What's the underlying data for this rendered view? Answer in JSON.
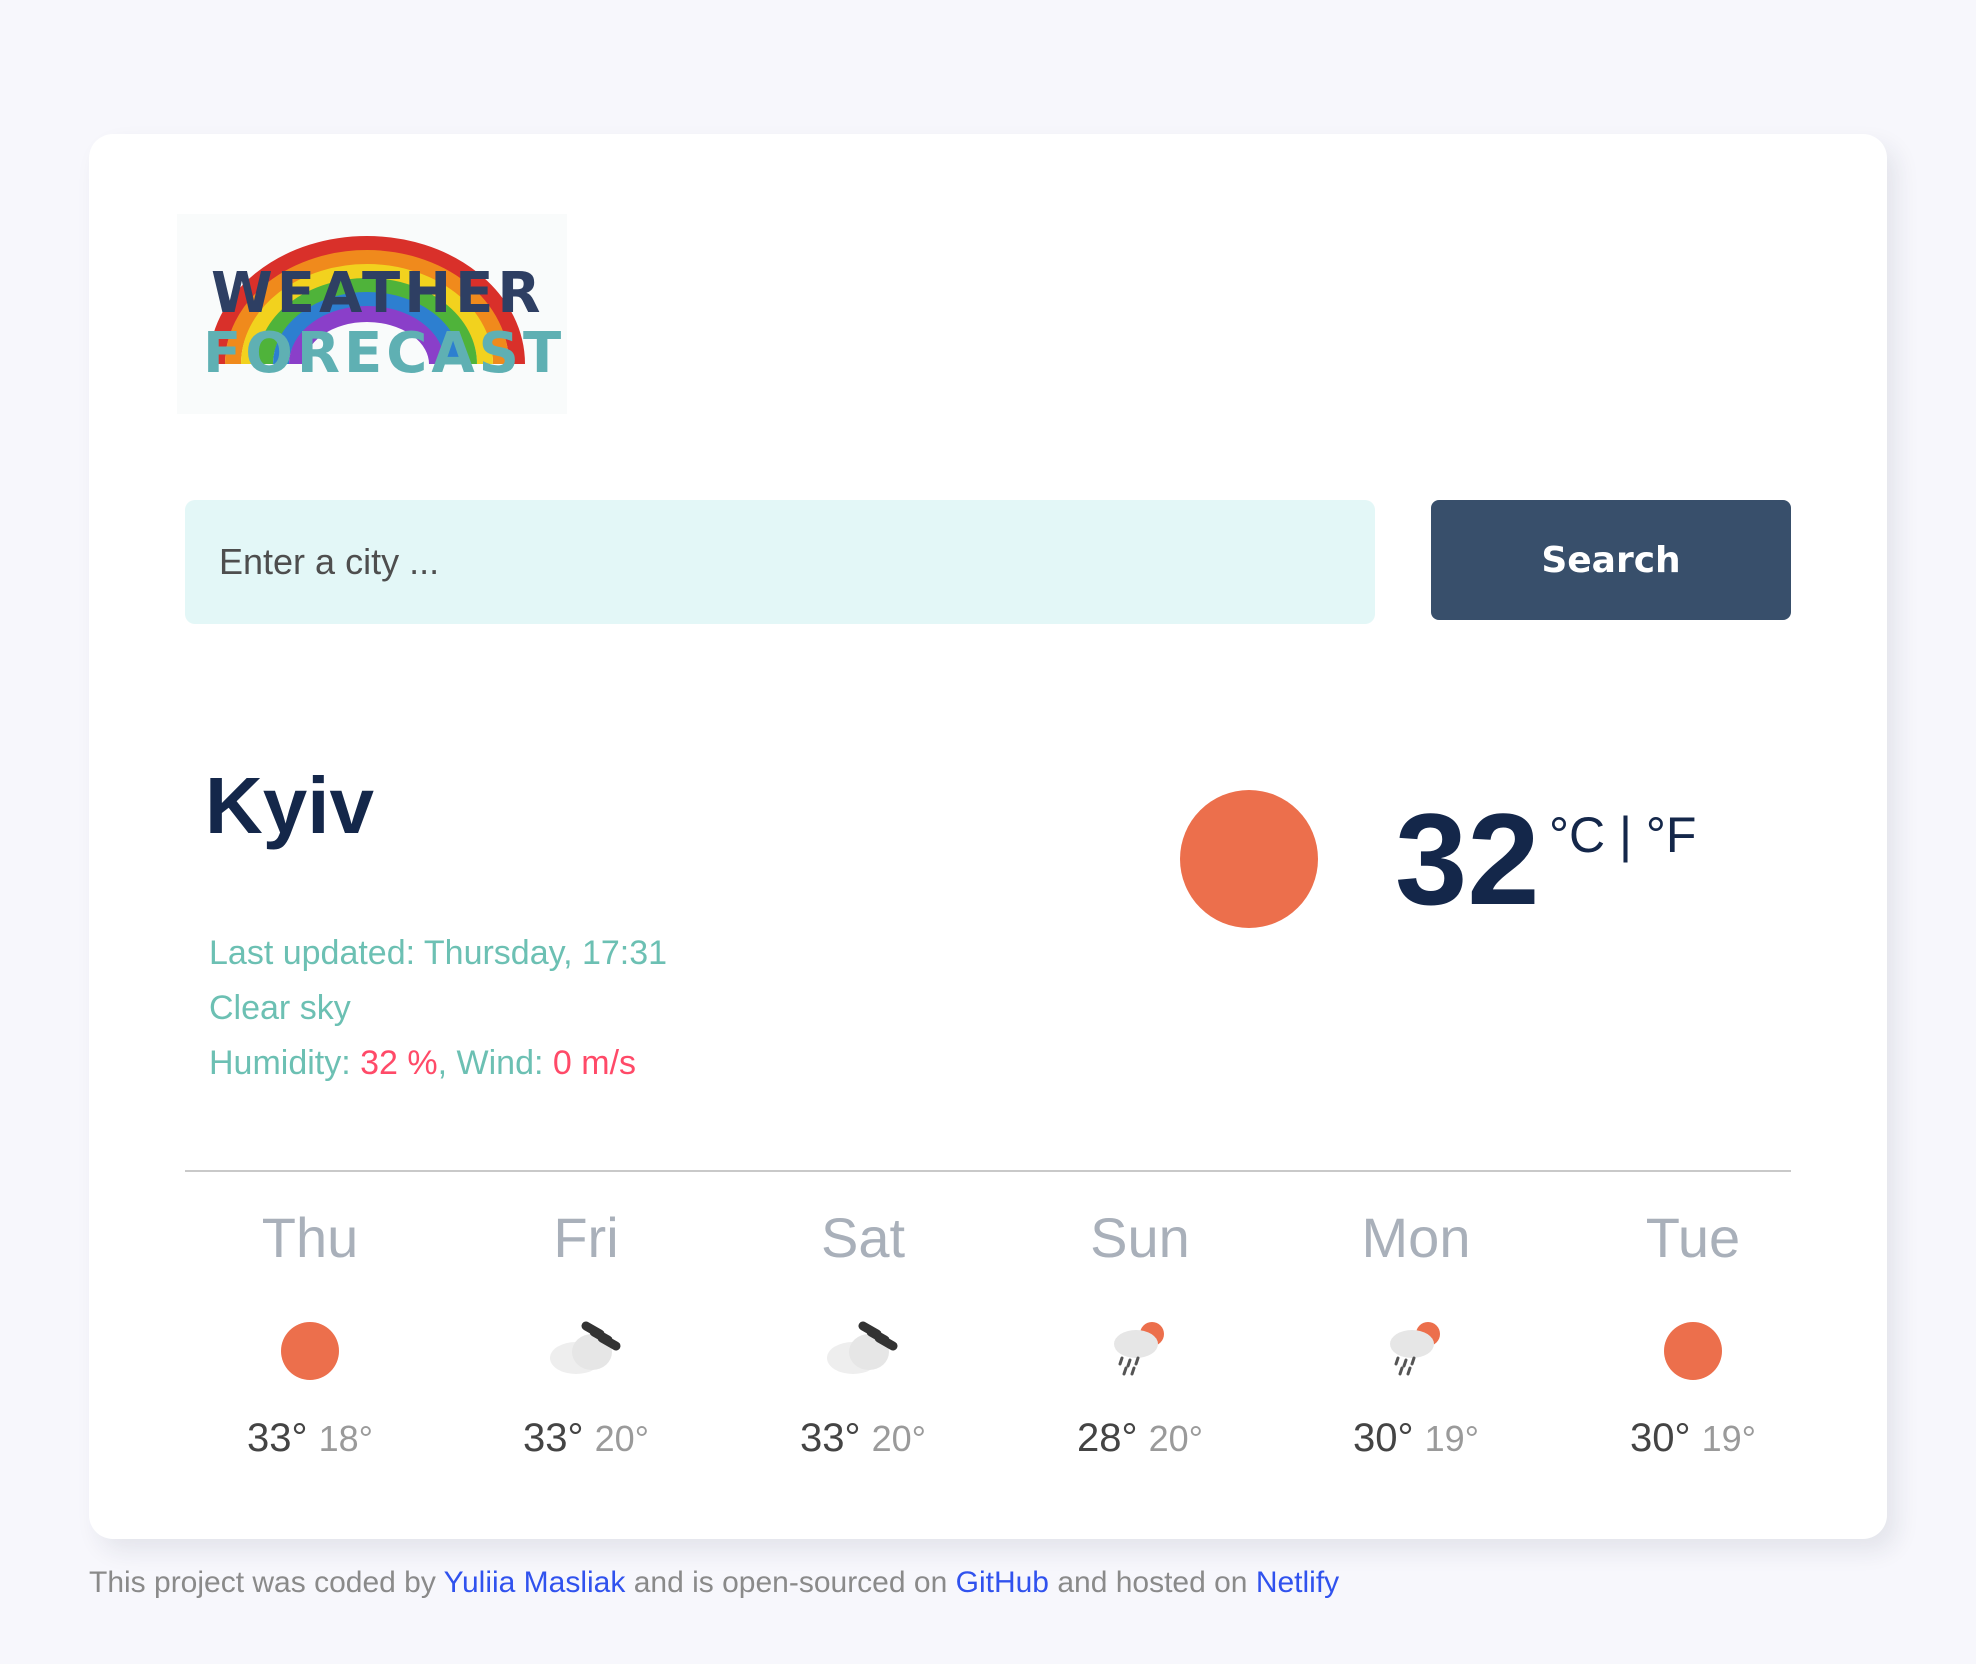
{
  "logo": {
    "line1": "WEATHER",
    "line2": "FORECAST"
  },
  "search": {
    "placeholder": "Enter a city ...",
    "button_label": "Search"
  },
  "current": {
    "city": "Kyiv",
    "last_updated_label": "Last updated: ",
    "last_updated": "Thursday, 17:31",
    "description": "Clear sky",
    "humidity_label": "Humidity: ",
    "humidity": "32 %",
    "wind_label": ", Wind: ",
    "wind": "0 m/s",
    "temperature": "32",
    "unit_c": "°C",
    "unit_sep": " | ",
    "unit_f": "°F",
    "icon": "sun-icon"
  },
  "forecast": [
    {
      "day": "Thu",
      "max": "33°",
      "min": "18°",
      "icon": "sun-icon"
    },
    {
      "day": "Fri",
      "max": "33°",
      "min": "20°",
      "icon": "cloud-icon"
    },
    {
      "day": "Sat",
      "max": "33°",
      "min": "20°",
      "icon": "cloud-icon"
    },
    {
      "day": "Sun",
      "max": "28°",
      "min": "20°",
      "icon": "rain-sun-icon"
    },
    {
      "day": "Mon",
      "max": "30°",
      "min": "19°",
      "icon": "rain-sun-icon"
    },
    {
      "day": "Tue",
      "max": "30°",
      "min": "19°",
      "icon": "sun-icon"
    }
  ],
  "footer": {
    "text1": "This project was coded by ",
    "author": "Yuliia Masliak",
    "text2": " and is open-sourced on ",
    "github": "GitHub",
    "text3": " and hosted on ",
    "netlify": "Netlify"
  },
  "colors": {
    "accent": "#384f6b",
    "title": "#14274a",
    "teal_text": "#6cc0b3",
    "highlight": "#ff4a68",
    "sun": "#ec6f4c",
    "input_bg": "#e3f7f7",
    "link": "#3052ee"
  }
}
